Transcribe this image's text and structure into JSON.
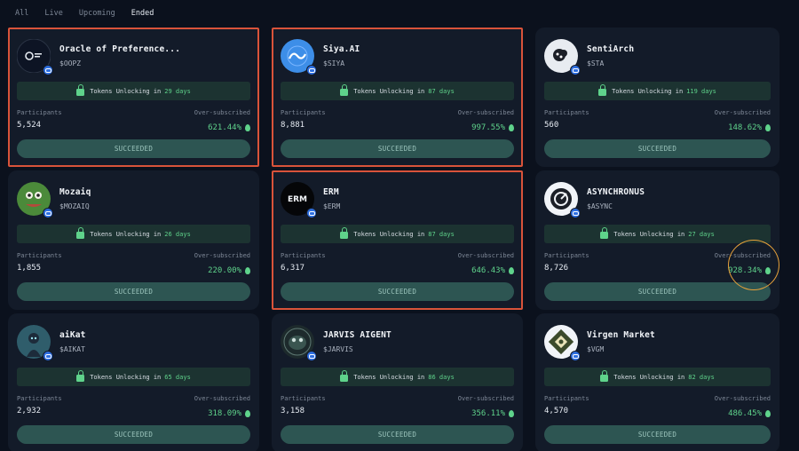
{
  "tabs": [
    "All",
    "Live",
    "Upcoming",
    "Ended"
  ],
  "active_tab": "Ended",
  "unlock_prefix": "Tokens Unlocking in",
  "labels": {
    "participants": "Participants",
    "oversubscribed": "Over-subscribed"
  },
  "colors": {
    "accent_green": "#5fd38b",
    "highlight_border": "#d9533a",
    "annotation_circle": "#e8a23a"
  },
  "cards": [
    {
      "name": "Oracle of Preference...",
      "ticker": "$OOPZ",
      "unlock_days": "29 days",
      "participants": "5,524",
      "oversubscribed": "621.44%",
      "status": "SUCCEEDED",
      "icon": "oopz-logo-icon",
      "highlighted": true
    },
    {
      "name": "Siya.AI",
      "ticker": "$SIYA",
      "unlock_days": "87 days",
      "participants": "8,881",
      "oversubscribed": "997.55%",
      "status": "SUCCEEDED",
      "icon": "siya-logo-icon",
      "highlighted": true
    },
    {
      "name": "SentiArch",
      "ticker": "$STA",
      "unlock_days": "119 days",
      "participants": "560",
      "oversubscribed": "148.62%",
      "status": "SUCCEEDED",
      "icon": "sentiarch-logo-icon",
      "highlighted": false
    },
    {
      "name": "Mozaiq",
      "ticker": "$MOZAIQ",
      "unlock_days": "26 days",
      "participants": "1,855",
      "oversubscribed": "220.00%",
      "status": "SUCCEEDED",
      "icon": "mozaiq-logo-icon",
      "highlighted": false
    },
    {
      "name": "ERM",
      "ticker": "$ERM",
      "unlock_days": "87 days",
      "participants": "6,317",
      "oversubscribed": "646.43%",
      "status": "SUCCEEDED",
      "icon": "erm-logo-icon",
      "highlighted": true
    },
    {
      "name": "ASYNCHRONUS",
      "ticker": "$ASYNC",
      "unlock_days": "27 days",
      "participants": "8,726",
      "oversubscribed": "928.34%",
      "status": "SUCCEEDED",
      "icon": "async-logo-icon",
      "highlighted": false
    },
    {
      "name": "aiKat",
      "ticker": "$AIKAT",
      "unlock_days": "65 days",
      "participants": "2,932",
      "oversubscribed": "318.09%",
      "status": "SUCCEEDED",
      "icon": "aikat-logo-icon",
      "highlighted": false
    },
    {
      "name": "JARVIS AIGENT",
      "ticker": "$JARVIS",
      "unlock_days": "86 days",
      "participants": "3,158",
      "oversubscribed": "356.11%",
      "status": "SUCCEEDED",
      "icon": "jarvis-logo-icon",
      "highlighted": false
    },
    {
      "name": "Virgen Market",
      "ticker": "$VGM",
      "unlock_days": "82 days",
      "participants": "4,570",
      "oversubscribed": "486.45%",
      "status": "SUCCEEDED",
      "icon": "virgen-logo-icon",
      "highlighted": false
    }
  ]
}
